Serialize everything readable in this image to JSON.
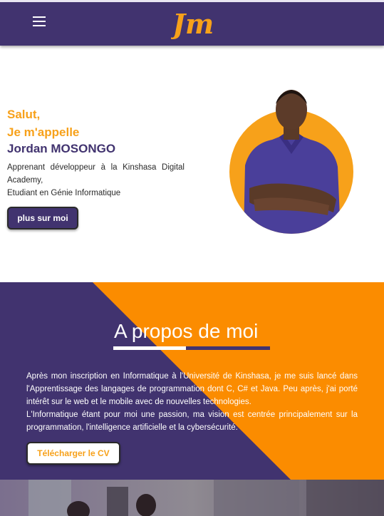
{
  "header": {
    "logo_text": "Jm",
    "menu_icon": "hamburger-menu-icon"
  },
  "hero": {
    "greeting_line1": "Salut,",
    "greeting_line2": "Je m'appelle",
    "name": "Jordan MOSONGO",
    "desc_line1": "Apprenant développeur à la Kinshasa Digital Academy,",
    "desc_line2": "Etudiant en Génie Informatique",
    "more_button": "plus sur moi"
  },
  "about": {
    "title": "A propos de moi",
    "paragraph1": "Après mon inscription en Informatique à l'Université de Kinshasa, je me suis lancé dans l'Apprentissage des langages de programmation dont C, C# et Java. Peu après, j'ai porté intérêt sur le web et le mobile avec de nouvelles technologies.",
    "paragraph2": "L'Informatique étant pour moi une passion, ma vision est centrée principalement sur la programmation, l'intelligence artificielle et la cybersécurité.",
    "cv_button": "Télécharger le CV"
  },
  "colors": {
    "purple": "#41336f",
    "orange": "#f7a11a",
    "white": "#ffffff"
  }
}
